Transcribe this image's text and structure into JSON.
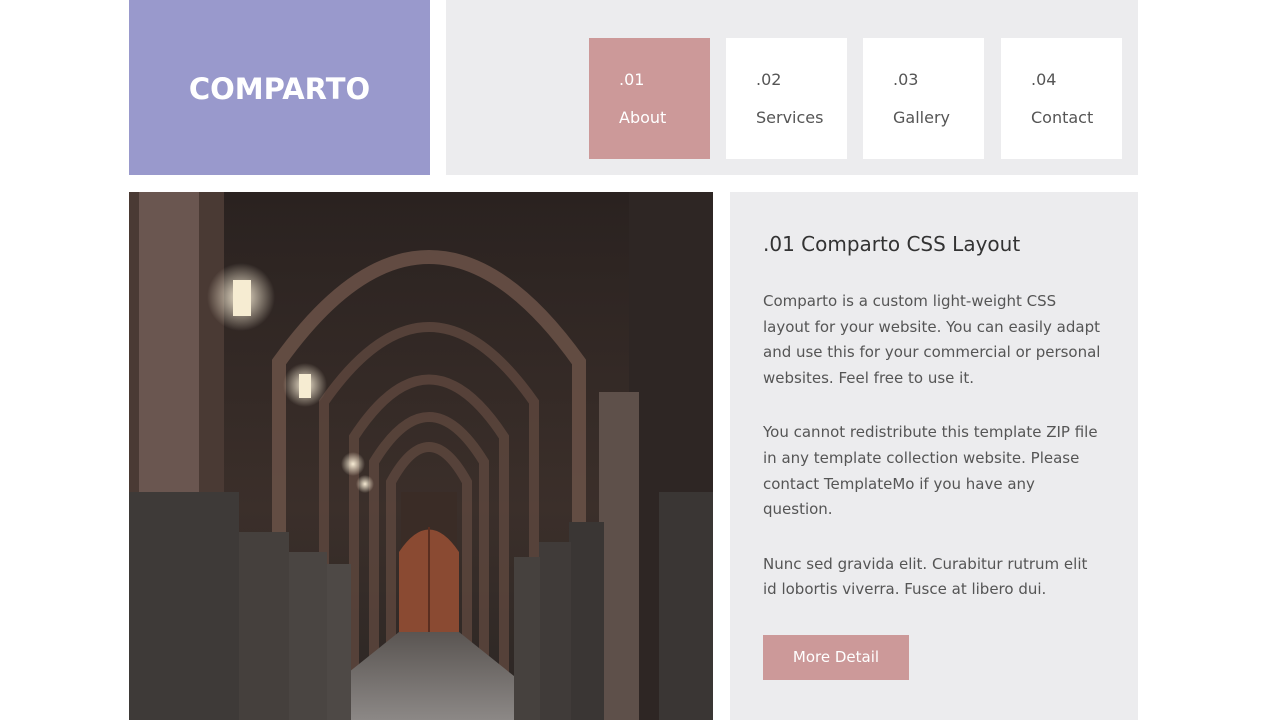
{
  "brand": {
    "logo_text": "COMPARTO"
  },
  "nav": {
    "items": [
      {
        "num": ".01",
        "label": "About"
      },
      {
        "num": ".02",
        "label": "Services"
      },
      {
        "num": ".03",
        "label": "Gallery"
      },
      {
        "num": ".04",
        "label": "Contact"
      }
    ],
    "active_index": 0
  },
  "hero": {
    "icon": "corridor-photo"
  },
  "content": {
    "title": ".01 Comparto CSS Layout",
    "paragraphs": [
      "Comparto is a custom light-weight CSS layout for your website. You can easily adapt and use this for your commercial or personal websites. Feel free to use it.",
      "You cannot redistribute this template ZIP file in any template collection website. Please contact TemplateMo if you have any question.",
      "Nunc sed gravida elit. Curabitur rutrum elit id lobortis viverra. Fusce at libero dui."
    ],
    "button_label": "More Detail"
  },
  "colors": {
    "accent_purple": "#9999cc",
    "accent_rose": "#cc9999",
    "panel_gray": "#ececee"
  }
}
